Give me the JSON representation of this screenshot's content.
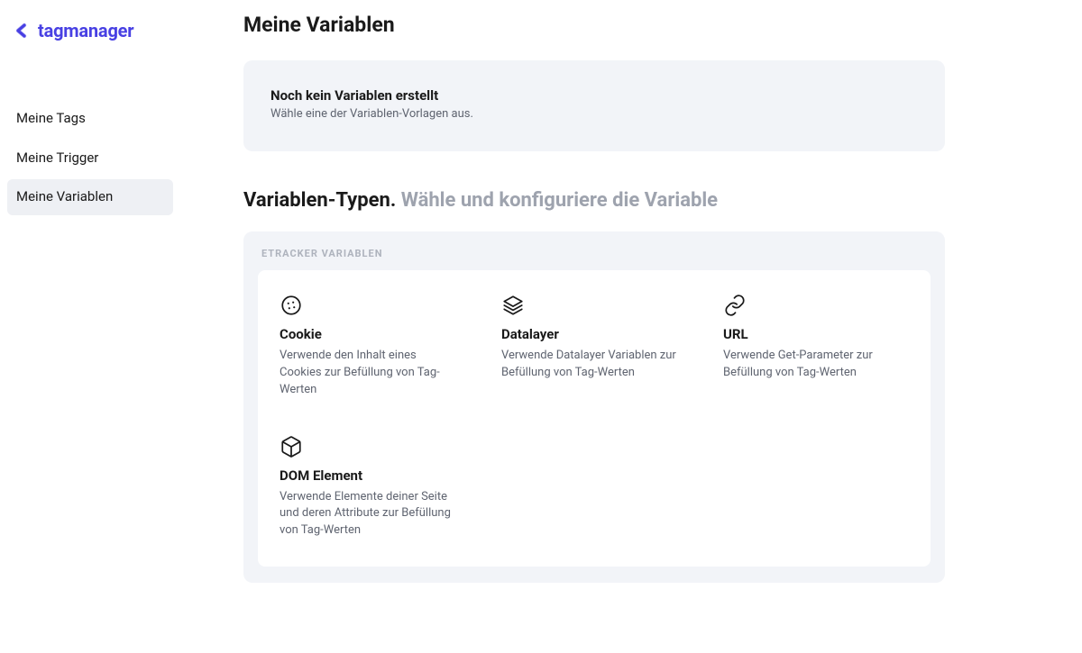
{
  "brand": {
    "name": "tagmanager"
  },
  "sidebar": {
    "items": [
      {
        "label": "Meine Tags",
        "active": false
      },
      {
        "label": "Meine Trigger",
        "active": false
      },
      {
        "label": "Meine Variablen",
        "active": true
      }
    ]
  },
  "page": {
    "title": "Meine Variablen",
    "empty_title": "Noch kein Variablen erstellt",
    "empty_subtitle": "Wähle eine der Variablen-Vorlagen aus.",
    "types_heading_strong": "Variablen-Typen. ",
    "types_heading_muted": "Wähle und konfiguriere die Variable",
    "types_group_label": "ETRACKER VARIABLEN"
  },
  "types": [
    {
      "icon": "cookie",
      "title": "Cookie",
      "desc": "Verwende den Inhalt eines Cookies zur Befüllung von Tag-Werten"
    },
    {
      "icon": "layers",
      "title": "Datalayer",
      "desc": "Verwende Datalayer Variablen zur Befüllung von Tag-Werten"
    },
    {
      "icon": "link",
      "title": "URL",
      "desc": "Verwende Get-Parameter zur Befüllung von Tag-Werten"
    },
    {
      "icon": "cube",
      "title": "DOM Element",
      "desc": "Verwende Elemente deiner Seite und deren Attribute zur Befüllung von Tag-Werten"
    }
  ]
}
